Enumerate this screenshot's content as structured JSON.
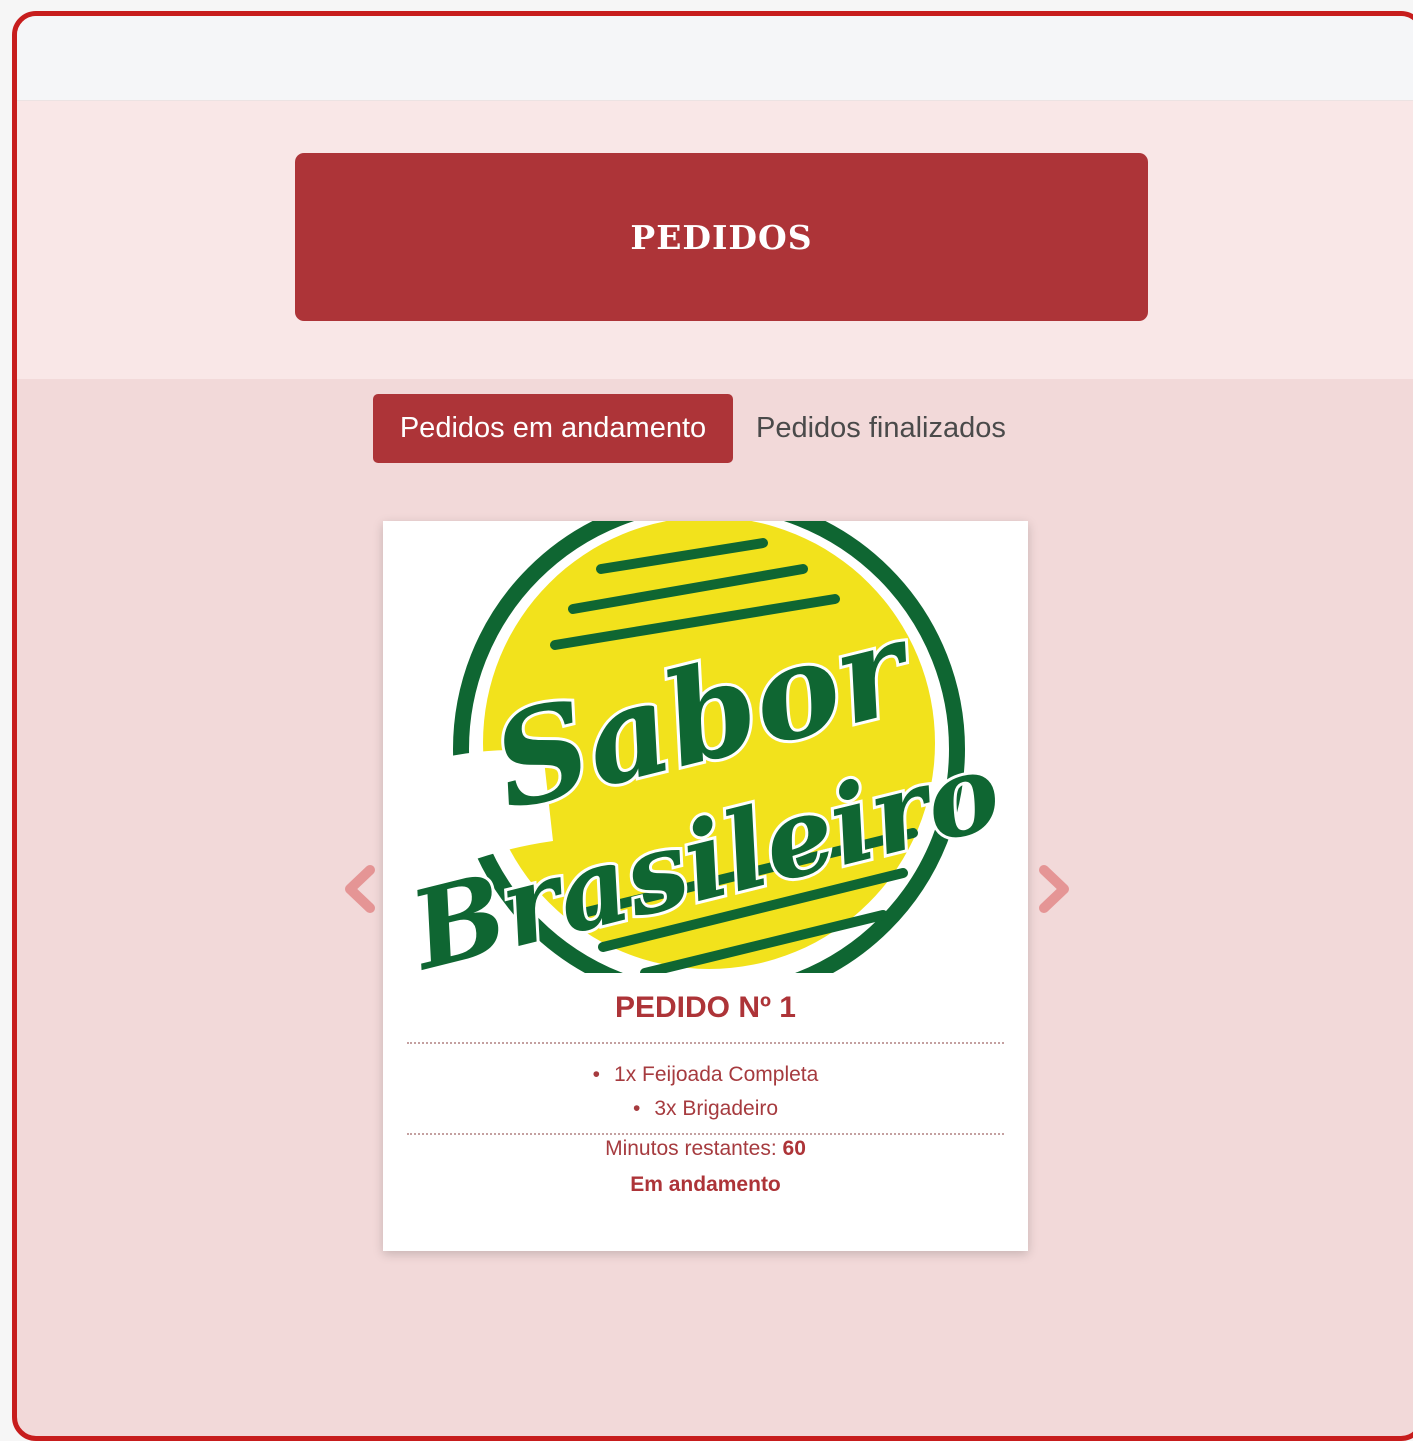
{
  "page": {
    "title": "PEDIDOS",
    "tabs": [
      {
        "label": "Pedidos em andamento",
        "active": true
      },
      {
        "label": "Pedidos finalizados",
        "active": false
      }
    ]
  },
  "order_card": {
    "logo": {
      "line1": "Sabor",
      "line2": "Brasileiro"
    },
    "title": "PEDIDO Nº 1",
    "items": [
      "1x Feijoada Completa",
      "3x Brigadeiro"
    ],
    "remaining_label": "Minutos restantes:",
    "remaining_value": "60",
    "status": "Em andamento"
  },
  "carousel": {
    "prev_icon": "chevron-left-icon",
    "next_icon": "chevron-right-icon"
  },
  "colors": {
    "accent": "#ad3438",
    "frame_border": "#c71d1d",
    "page_bg": "#f2d9d9",
    "hero_bg": "#f9e7e7",
    "logo_green": "#0f6632",
    "logo_yellow": "#f2e21c",
    "arrow": "#e59595"
  }
}
